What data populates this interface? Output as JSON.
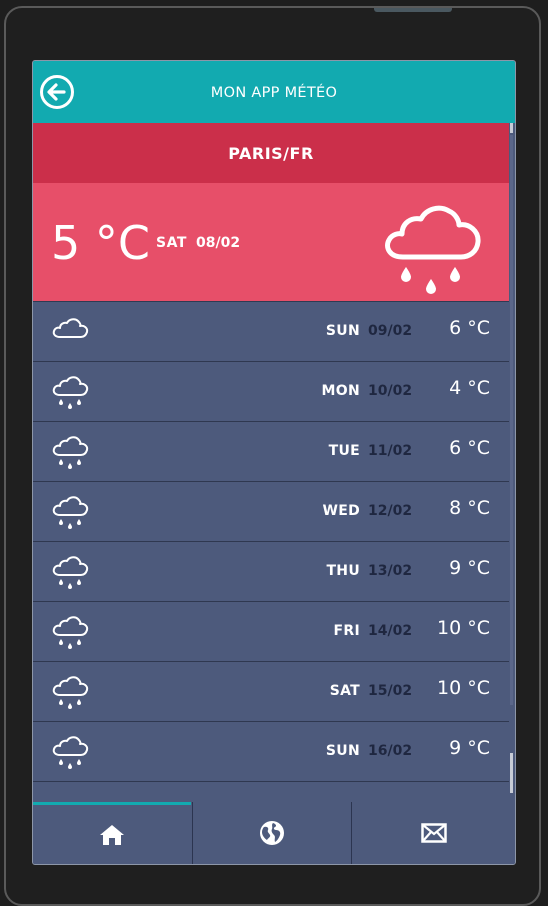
{
  "app": {
    "title": "MON APP MÉTÉO",
    "city": "PARIS/FR",
    "accent_color": "#12aab0",
    "city_bar_color": "#cb2f4a",
    "current_bg_color": "#e74f69",
    "list_bg_color": "#4d5a7c"
  },
  "current": {
    "temp": "5 °C",
    "day": "SAT",
    "date": "08/02",
    "icon": "rain-cloud-icon"
  },
  "forecast": [
    {
      "day": "SUN",
      "date": "09/02",
      "temp": "6 °C",
      "icon": "cloud-icon"
    },
    {
      "day": "MON",
      "date": "10/02",
      "temp": "4 °C",
      "icon": "rain-cloud-icon"
    },
    {
      "day": "TUE",
      "date": "11/02",
      "temp": "6 °C",
      "icon": "rain-cloud-icon"
    },
    {
      "day": "WED",
      "date": "12/02",
      "temp": "8 °C",
      "icon": "rain-cloud-icon"
    },
    {
      "day": "THU",
      "date": "13/02",
      "temp": "9 °C",
      "icon": "rain-cloud-icon"
    },
    {
      "day": "FRI",
      "date": "14/02",
      "temp": "10 °C",
      "icon": "rain-cloud-icon"
    },
    {
      "day": "SAT",
      "date": "15/02",
      "temp": "10 °C",
      "icon": "rain-cloud-icon"
    },
    {
      "day": "SUN",
      "date": "16/02",
      "temp": "9 °C",
      "icon": "rain-cloud-icon"
    }
  ],
  "nav": {
    "tabs": [
      {
        "icon": "home-icon",
        "active": true
      },
      {
        "icon": "globe-icon",
        "active": false
      },
      {
        "icon": "mail-icon",
        "active": false
      }
    ]
  }
}
